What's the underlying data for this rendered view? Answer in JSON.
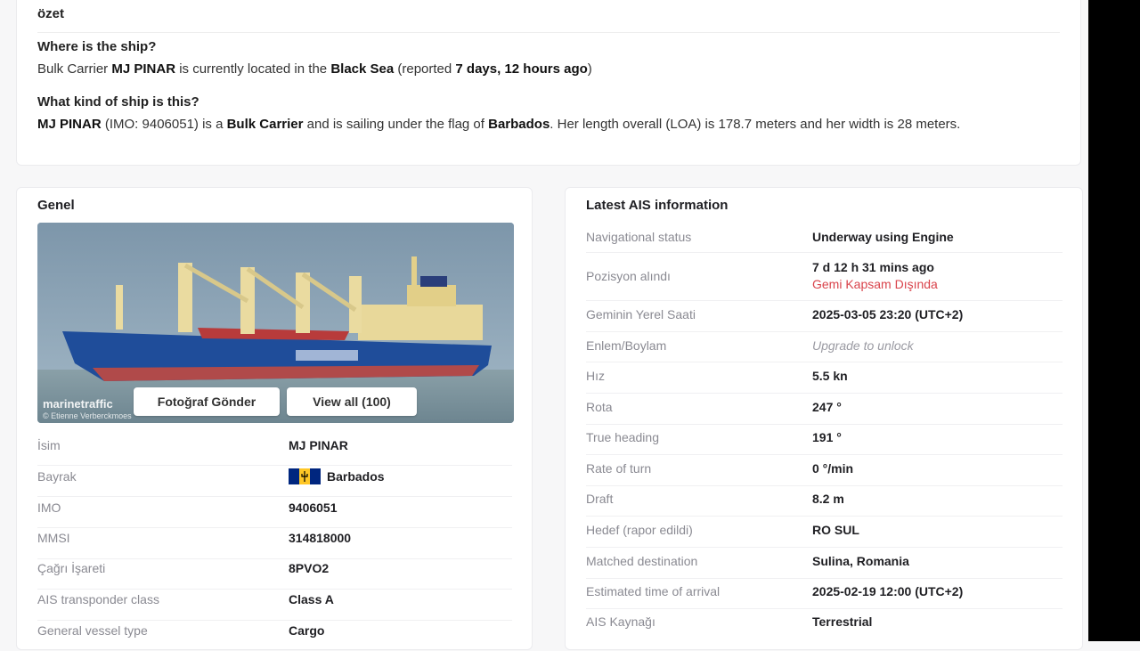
{
  "summary": {
    "section_label": "özet",
    "where_title": "Where is the ship?",
    "where_text": {
      "t1": "Bulk Carrier ",
      "ship_name": "MJ PINAR",
      "t2": " is currently located in the ",
      "location": "Black Sea",
      "t3": " (reported ",
      "reported": "7 days, 12 hours ago",
      "t4": ")"
    },
    "kind_title": "What kind of ship is this?",
    "kind_text": {
      "ship_name": "MJ PINAR",
      "t1": " (IMO: 9406051) is a ",
      "type": "Bulk Carrier",
      "t2": " and is sailing under the flag of ",
      "flag": "Barbados",
      "t3": ". Her length overall (LOA) is 178.7 meters and her width is 28 meters."
    }
  },
  "genel": {
    "title": "Genel",
    "photo": {
      "send_button": "Fotoğraf Gönder",
      "view_all_button": "View all (100)",
      "watermark": "marinetraffic",
      "credit": "© Etienne Verberckmoes"
    },
    "rows": [
      {
        "key": "İsim",
        "value": "MJ PINAR"
      },
      {
        "key": "Bayrak",
        "value": "Barbados"
      },
      {
        "key": "IMO",
        "value": "9406051"
      },
      {
        "key": "MMSI",
        "value": "314818000"
      },
      {
        "key": "Çağrı İşareti",
        "value": "8PVO2"
      },
      {
        "key": "AIS transponder class",
        "value": "Class A"
      },
      {
        "key": "General vessel type",
        "value": "Cargo"
      }
    ],
    "flag_colors": {
      "blue": "#00267f",
      "gold": "#ffc726",
      "trident": "#000000"
    }
  },
  "ais": {
    "title": "Latest AIS information",
    "rows": [
      {
        "key": "Navigational status",
        "value": "Underway using Engine"
      },
      {
        "key": "Pozisyon alındı",
        "value": "7 d 12 h 31 mins ago",
        "sub": "Gemi Kapsam Dışında"
      },
      {
        "key": "Geminin Yerel Saati",
        "value": "2025-03-05 23:20 (UTC+2)"
      },
      {
        "key": "Enlem/Boylam",
        "value": "Upgrade to unlock"
      },
      {
        "key": "Hız",
        "value": "5.5 kn"
      },
      {
        "key": "Rota",
        "value": "247 °"
      },
      {
        "key": "True heading",
        "value": "191 °"
      },
      {
        "key": "Rate of turn",
        "value": "0 °/min"
      },
      {
        "key": "Draft",
        "value": "8.2 m"
      },
      {
        "key": "Hedef (rapor edildi)",
        "value": "RO SUL"
      },
      {
        "key": "Matched destination",
        "value": "Sulina, Romania"
      },
      {
        "key": "Estimated time of arrival",
        "value": "2025-02-19 12:00 (UTC+2)"
      },
      {
        "key": "AIS Kaynağı",
        "value": "Terrestrial"
      }
    ]
  },
  "colors": {
    "warning": "#d9434b",
    "key_text": "#8a8a92"
  }
}
